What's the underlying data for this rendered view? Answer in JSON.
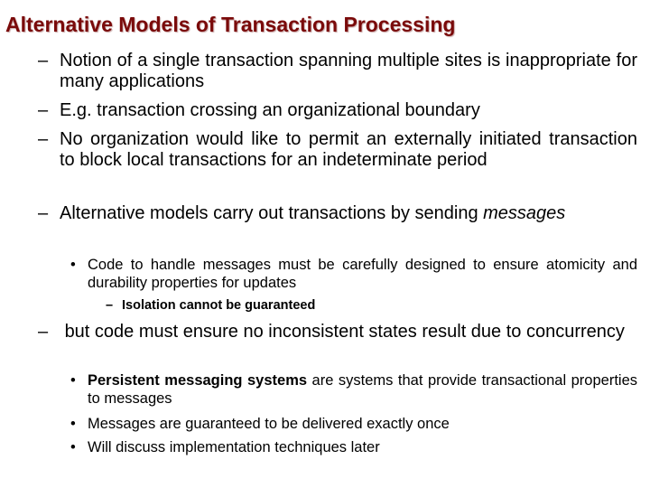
{
  "slide": {
    "title": "Alternative Models of Transaction Processing",
    "title_color": "#7a0a0a",
    "items": [
      {
        "level": 1,
        "marker": "–",
        "text": "Notion of a single transaction spanning multiple sites is inappropriate for many applications"
      },
      {
        "level": 1,
        "marker": "–",
        "text": "E.g. transaction crossing an organizational boundary"
      },
      {
        "level": 1,
        "marker": "–",
        "text": "No organization would like to permit an externally initiated transaction  to block local transactions for an indeterminate period"
      },
      {
        "level": 1,
        "marker": "–",
        "text_prefix": "Alternative models carry out transactions by sending ",
        "text_emphasis": "messages"
      },
      {
        "level": 2,
        "marker": "•",
        "text": "Code to handle messages must be carefully designed to ensure atomicity and durability properties for updates"
      },
      {
        "level": 3,
        "marker": "–",
        "text": "Isolation cannot be guaranteed"
      },
      {
        "level": 1,
        "marker": "–",
        "text": " but code must ensure no inconsistent states result due to concurrency"
      },
      {
        "level": 2,
        "marker": "•",
        "text_bold": "Persistent messaging systems",
        "text_rest": " are systems that provide transactional properties to messages"
      },
      {
        "level": 2,
        "marker": "•",
        "text": "Messages are guaranteed to be delivered exactly once"
      },
      {
        "level": 2,
        "marker": "•",
        "text": "Will discuss implementation techniques later"
      }
    ]
  }
}
